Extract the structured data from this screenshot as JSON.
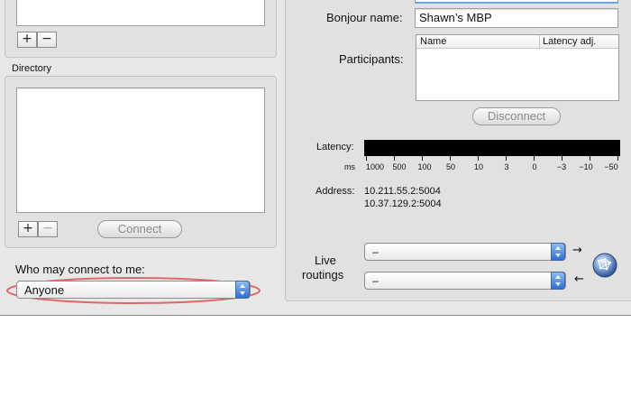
{
  "left": {
    "top_list": {
      "add": "+",
      "remove": "−"
    },
    "directory": {
      "title": "Directory",
      "add": "+",
      "remove": "−",
      "connect": "Connect"
    },
    "who_may_connect": {
      "label": "Who may connect to me:",
      "value": "Anyone"
    }
  },
  "right": {
    "bonjour": {
      "label": "Bonjour name:",
      "value": "Shawn’s MBP"
    },
    "participants": {
      "label": "Participants:",
      "columns": [
        "Name",
        "Latency adj."
      ]
    },
    "disconnect": "Disconnect",
    "latency": {
      "label": "Latency:",
      "unit": "ms",
      "scale": [
        "1000",
        "500",
        "100",
        "50",
        "10",
        "3",
        "0",
        "−3",
        "−10",
        "−50"
      ]
    },
    "address": {
      "label": "Address:",
      "values": [
        "10.211.55.2:5004",
        "10.37.129.2:5004"
      ]
    },
    "live_routings": {
      "label_line1": "Live",
      "label_line2": "routings",
      "in_value": "–",
      "out_value": "–",
      "in_arrow": "→",
      "out_arrow": "←"
    },
    "globe_icon": "network-globe-icon"
  }
}
